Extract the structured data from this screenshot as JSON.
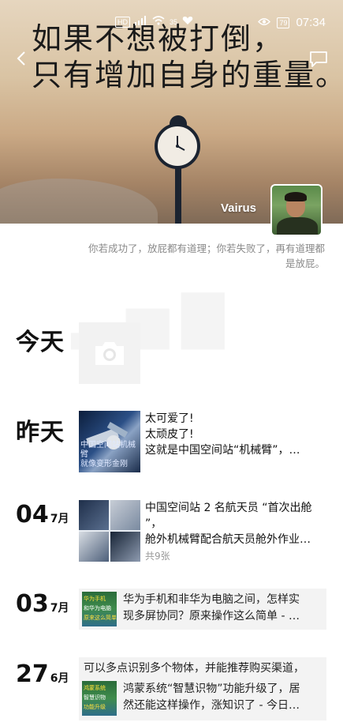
{
  "status_bar": {
    "network_badge": "HD",
    "signal_text": "4G",
    "speed": "35",
    "battery": "79",
    "time": "07:34"
  },
  "cover": {
    "quote_line1": "如果不想被打倒，",
    "quote_line2": "只有增加自身的重量。",
    "username": "Vairus"
  },
  "signature": "你若成功了，放屁都有道理；你若失败了，再有道理都是放屁。",
  "moments": {
    "today": {
      "label": "今天"
    },
    "yesterday": {
      "label": "昨天",
      "thumb_caption_1": "中国空间站机械臂",
      "thumb_caption_2": "就像变形金刚",
      "lines": [
        "太可爱了!",
        "太顽皮了!",
        "这就是中国空间站“机械臂”，…"
      ]
    },
    "jul04": {
      "day": "04",
      "month": "7月",
      "lines": [
        "中国空间站 2 名航天员 “首次出舱",
        "”，",
        "舱外机械臂配合航天员舱外作业…"
      ],
      "count": "共9张"
    },
    "jul03": {
      "day": "03",
      "month": "7月",
      "thumb_l1": "华为手机",
      "thumb_l2": "和华为电脑",
      "thumb_l3": "原来这么简单",
      "lines": [
        "华为手机和非华为电脑之间，怎样实",
        "现多屏协同？原来操作这么简单 - …"
      ]
    },
    "jun27": {
      "day": "27",
      "month": "6月",
      "header": "可以多点识别多个物体，并能推荐购买渠道，",
      "thumb_l1": "鸿蒙系统",
      "thumb_l2": "智慧识物",
      "thumb_l3": "功能升级",
      "lines": [
        "鸿蒙系统“智慧识物”功能升级了，居",
        "然还能这样操作，涨知识了 - 今日…"
      ]
    }
  }
}
